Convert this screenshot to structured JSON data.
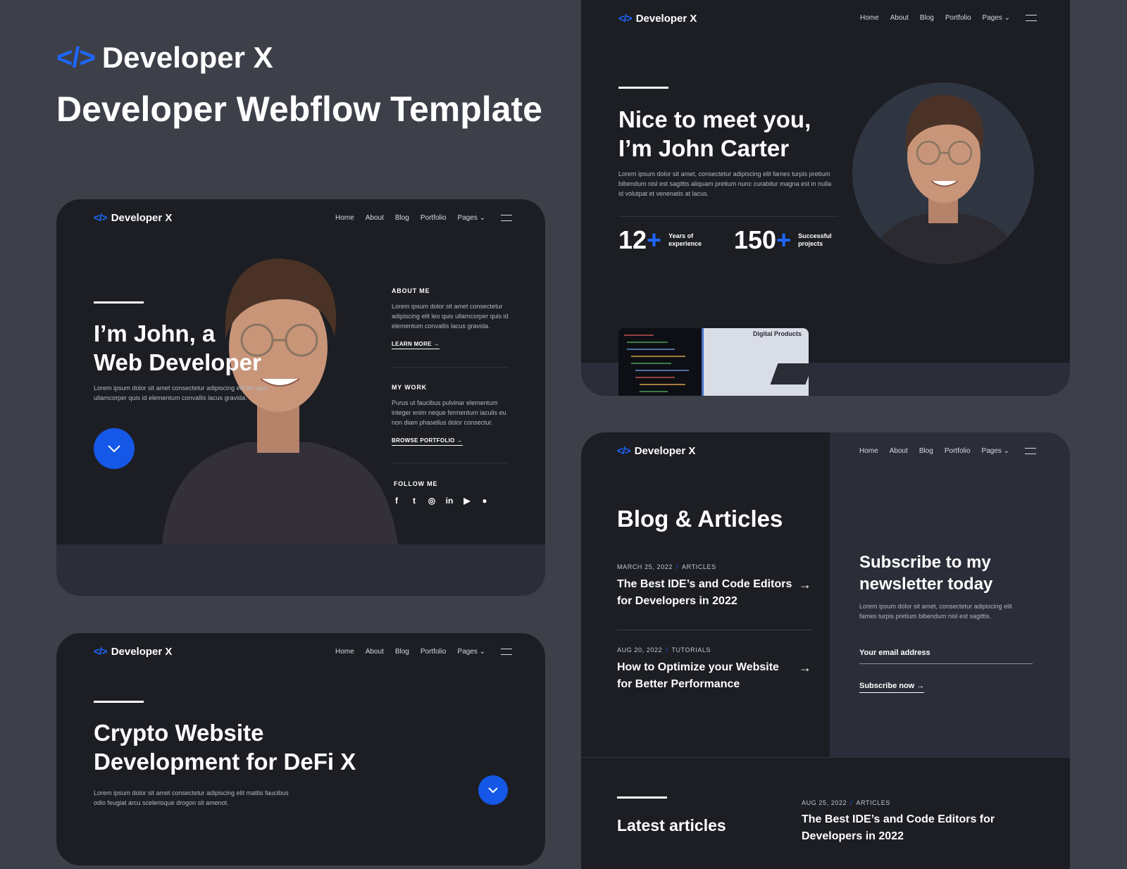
{
  "brand": {
    "logo_glyph": "</>",
    "name": "Developer X",
    "tagline": "Developer Webflow Template"
  },
  "nav": {
    "items": [
      "Home",
      "About",
      "Blog",
      "Portfolio",
      "Pages"
    ]
  },
  "hero1": {
    "title_line1": "I’m John, a",
    "title_line2": "Web Developer",
    "desc": "Lorem ipsum dolor sit amet consectetur adipiscing elit leo quis ullamcorper quis id elementum convallis lacus gravida.",
    "about_label": "ABOUT ME",
    "about_text": "Lorem ipsum dolor sit amet consectetur adipiscing elit leo quis ullamcorper quis id elementum convallis lacus gravida.",
    "about_link": "LEARN MORE",
    "work_label": "MY WORK",
    "work_text": "Purus ut faucibus pulvinar elementum integer enim neque fermentum iaculis eu non diam phasellus dolor consectur.",
    "work_link": "BROWSE PORTFOLIO",
    "follow_label": "FOLLOW ME",
    "social_icons": [
      "facebook-icon",
      "twitter-icon",
      "instagram-icon",
      "linkedin-icon",
      "youtube-icon",
      "github-icon"
    ]
  },
  "about_card": {
    "title_line1": "Nice to meet you,",
    "title_line2": "I’m John Carter",
    "desc": "Lorem ipsum dolor sit amet, consectetur adipiscing elit fames turpis pretium bibendum nisl est sagittis aliquam pretium nunc curabitur magna est in nulla id volutpat et venenatis at lacus.",
    "stat1_value": "12",
    "stat1_label_line1": "Years of",
    "stat1_label_line2": "experience",
    "stat2_value": "150",
    "stat2_label_line1": "Successful",
    "stat2_label_line2": "projects",
    "plus": "+",
    "thumb_caption": "Digital Products"
  },
  "blog_card": {
    "title": "Blog & Articles",
    "posts": [
      {
        "date": "MARCH 25, 2022",
        "category": "ARTICLES",
        "title_line1": "The Best IDE’s and Code Editors",
        "title_line2": "for Developers in 2022"
      },
      {
        "date": "AUG 20, 2022",
        "category": "TUTORIALS",
        "title_line1": "How to Optimize your Website",
        "title_line2": "for Better Performance"
      }
    ],
    "sep": "/",
    "newsletter_title_line1": "Subscribe to my",
    "newsletter_title_line2": "newsletter today",
    "newsletter_desc": "Lorem ipsum dolor sit amet, consectetur adipiscing elit fames turpis pretium bibendum nisl est sagittis.",
    "email_placeholder": "Your email address",
    "subscribe_label": "Subscribe now",
    "latest_title": "Latest articles",
    "latest_date": "AUG 25, 2022",
    "latest_category": "ARTICLES",
    "latest_post_line1": "The Best IDE’s and Code Editors for",
    "latest_post_line2": "Developers in 2022"
  },
  "crypto_card": {
    "title_line1": "Crypto Website",
    "title_line2": "Development for DeFi X",
    "desc_line1": "Lorem ipsum dolor sit amet consectetur adipiscing elit mattis faucibus",
    "desc_line2": "odio feugiat arcu scelerisque drogon sit amenot."
  },
  "colors": {
    "accent": "#1557e6",
    "page_bg": "#3d4049",
    "card_bg": "#1c1e24",
    "panel_bg": "#2b2e38"
  }
}
